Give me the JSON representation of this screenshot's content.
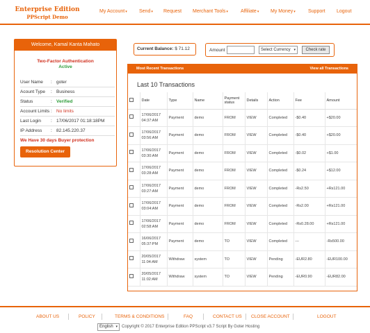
{
  "brand": {
    "line1": "Enterprise Edition",
    "line2": "PPScript Demo"
  },
  "nav": [
    {
      "label": "My Account",
      "dropdown": true
    },
    {
      "label": "Send",
      "dropdown": true
    },
    {
      "label": "Request",
      "dropdown": false
    },
    {
      "label": "Merchant Tools",
      "dropdown": true
    },
    {
      "label": "Affiliate",
      "dropdown": true
    },
    {
      "label": "My Money",
      "dropdown": true
    },
    {
      "label": "Support",
      "dropdown": false
    },
    {
      "label": "Logout",
      "dropdown": false
    }
  ],
  "welcome": {
    "title": "Welcome, Kamal Kanta Mahato",
    "tfa_title": "Two-Factor Authentication",
    "tfa_status": "Active",
    "fields": [
      {
        "key": "User Name",
        "value": "goter",
        "style": ""
      },
      {
        "key": "Acount Type",
        "value": "Business",
        "style": ""
      },
      {
        "key": "Status",
        "value": "Verified",
        "style": "grn"
      },
      {
        "key": "Account Limits",
        "value": "No limits",
        "style": "red"
      },
      {
        "key": "Last Login",
        "value": "17/06/2017 01:18:18PM",
        "style": ""
      },
      {
        "key": "IP Address",
        "value": "82.145.220.37",
        "style": ""
      }
    ],
    "protection": "We Have 30 days Buyer protection",
    "resolution_button": "Resolution Center"
  },
  "balance": {
    "label": "Current Balance:",
    "value": "$ 71.12"
  },
  "exchange": {
    "amount_label": "Amount",
    "amount_value": "",
    "currency_placeholder": "Select Currency",
    "check_button": "Check rate"
  },
  "transactions": {
    "header_left": "Most Recent Transactions",
    "header_right": "View all Transactions",
    "title": "Last 10 Transactions",
    "columns": [
      "",
      "Date",
      "Type",
      "Name",
      "Payment status",
      "Details",
      "Action",
      "Fee",
      "Amount"
    ],
    "rows": [
      {
        "date": "17/06/2017 04:37:AM",
        "type": "Payment",
        "name": "demo",
        "pstatus": "FROM",
        "details": "VIEW",
        "action": "Completed",
        "fee": "-$0.40",
        "amount": "+$20.00",
        "amount_sign": "pos"
      },
      {
        "date": "17/06/2017 03:56:AM",
        "type": "Payment",
        "name": "demo",
        "pstatus": "FROM",
        "details": "VIEW",
        "action": "Completed",
        "fee": "-$0.40",
        "amount": "+$20.00",
        "amount_sign": "pos"
      },
      {
        "date": "17/06/2017 03:30:AM",
        "type": "Payment",
        "name": "demo",
        "pstatus": "FROM",
        "details": "VIEW",
        "action": "Completed",
        "fee": "-$0.02",
        "amount": "+$1.00",
        "amount_sign": "pos"
      },
      {
        "date": "17/06/2017 03:28:AM",
        "type": "Payment",
        "name": "demo",
        "pstatus": "FROM",
        "details": "VIEW",
        "action": "Completed",
        "fee": "-$0.24",
        "amount": "+$12.00",
        "amount_sign": "pos"
      },
      {
        "date": "17/06/2017 03:27:AM",
        "type": "Payment",
        "name": "demo",
        "pstatus": "FROM",
        "details": "VIEW",
        "action": "Completed",
        "fee": "-Rs2.50",
        "amount": "+Rs121.00",
        "amount_sign": "pos"
      },
      {
        "date": "17/06/2017 03:04:AM",
        "type": "Payment",
        "name": "demo",
        "pstatus": "FROM",
        "details": "VIEW",
        "action": "Completed",
        "fee": "-Rs2.00",
        "amount": "+Rs121.00",
        "amount_sign": "pos"
      },
      {
        "date": "17/06/2017 02:58:AM",
        "type": "Payment",
        "name": "demo",
        "pstatus": "FROM",
        "details": "VIEW",
        "action": "Completed",
        "fee": "-Rs0.28.00",
        "amount": "+Rs121.00",
        "amount_sign": "pos"
      },
      {
        "date": "16/06/2017 05:37:PM",
        "type": "Payment",
        "name": "demo",
        "pstatus": "TO",
        "details": "VIEW",
        "action": "Completed",
        "fee": "---",
        "amount": "-Rs500.00",
        "amount_sign": "neg"
      },
      {
        "date": "20/05/2017 11:04:AM",
        "type": "Withdraw",
        "name": "system",
        "pstatus": "TO",
        "details": "VIEW",
        "action": "Pending",
        "fee": "-EUR2.80",
        "amount": "-EUR100.00",
        "amount_sign": "neg"
      },
      {
        "date": "20/05/2017 11:02:AM",
        "type": "Withdraw",
        "name": "system",
        "pstatus": "TO",
        "details": "VIEW",
        "action": "Pending",
        "fee": "-EUR0.90",
        "amount": "-EUR82.00",
        "amount_sign": "neg"
      }
    ]
  },
  "footer": {
    "links": [
      "ABOUT US",
      "POLICY",
      "TERMS & CONDITIONS",
      "FAQ",
      "CONTACT US",
      "CLOSE ACCOUNT",
      "LOGOUT"
    ],
    "language": "English",
    "copyright": "Copyright © 2017 Enterprise Edition PPScript v3.7 Script By Goter Hosting"
  },
  "colors": {
    "accent": "#e8630a",
    "success": "#2e9c3a",
    "danger": "#d0301e",
    "pending": "#2b58c8"
  }
}
